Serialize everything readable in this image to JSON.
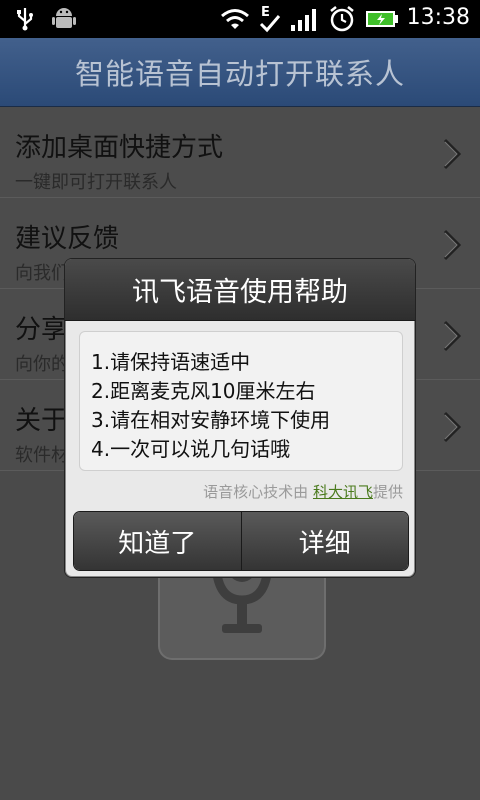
{
  "status_bar": {
    "time": "13:38",
    "icons": [
      "usb-icon",
      "android-debug-icon",
      "wifi-icon",
      "edge-signal-icon",
      "signal-bars-icon",
      "alarm-icon",
      "battery-charging-icon"
    ]
  },
  "app": {
    "title": "智能语音自动打开联系人"
  },
  "list": {
    "items": [
      {
        "title": "添加桌面快捷方式",
        "subtitle": "一键即可打开联系人"
      },
      {
        "title": "建议反馈",
        "subtitle": "向我们"
      },
      {
        "title": "分享",
        "subtitle": "向你的"
      },
      {
        "title": "关于",
        "subtitle": "软件材"
      }
    ]
  },
  "dialog": {
    "title": "讯飞语音使用帮助",
    "lines": [
      "1.请保持语速适中",
      "2.距离麦克风10厘米左右",
      "3.请在相对安静环境下使用",
      "4.一次可以说几句话哦"
    ],
    "credit_prefix": "语音核心技术由",
    "credit_link": "科大讯飞",
    "credit_suffix": "提供",
    "ok_label": "知道了",
    "details_label": "详细"
  },
  "colors": {
    "titlebar": "#2b4a77",
    "link": "#4a7a1c"
  }
}
